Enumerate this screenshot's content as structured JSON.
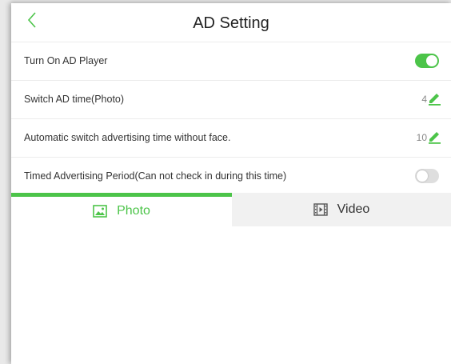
{
  "header": {
    "title": "AD Setting",
    "back_icon": "chevron-left-icon"
  },
  "settings": [
    {
      "label": "Turn On AD Player",
      "control": "toggle",
      "on": true
    },
    {
      "label": "Switch AD time(Photo)",
      "control": "edit",
      "value": "4"
    },
    {
      "label": "Automatic switch advertising time without face.",
      "control": "edit",
      "value": "10"
    },
    {
      "label": "Timed Advertising Period(Can not check in during this time)",
      "control": "toggle",
      "on": false
    }
  ],
  "tabs": [
    {
      "label": "Photo",
      "icon": "image-icon",
      "active": true
    },
    {
      "label": "Video",
      "icon": "video-icon",
      "active": false
    }
  ],
  "colors": {
    "accent": "#4cc449",
    "toggle_off": "#dedede",
    "inactive_tab_bg": "#f1f1f1"
  }
}
